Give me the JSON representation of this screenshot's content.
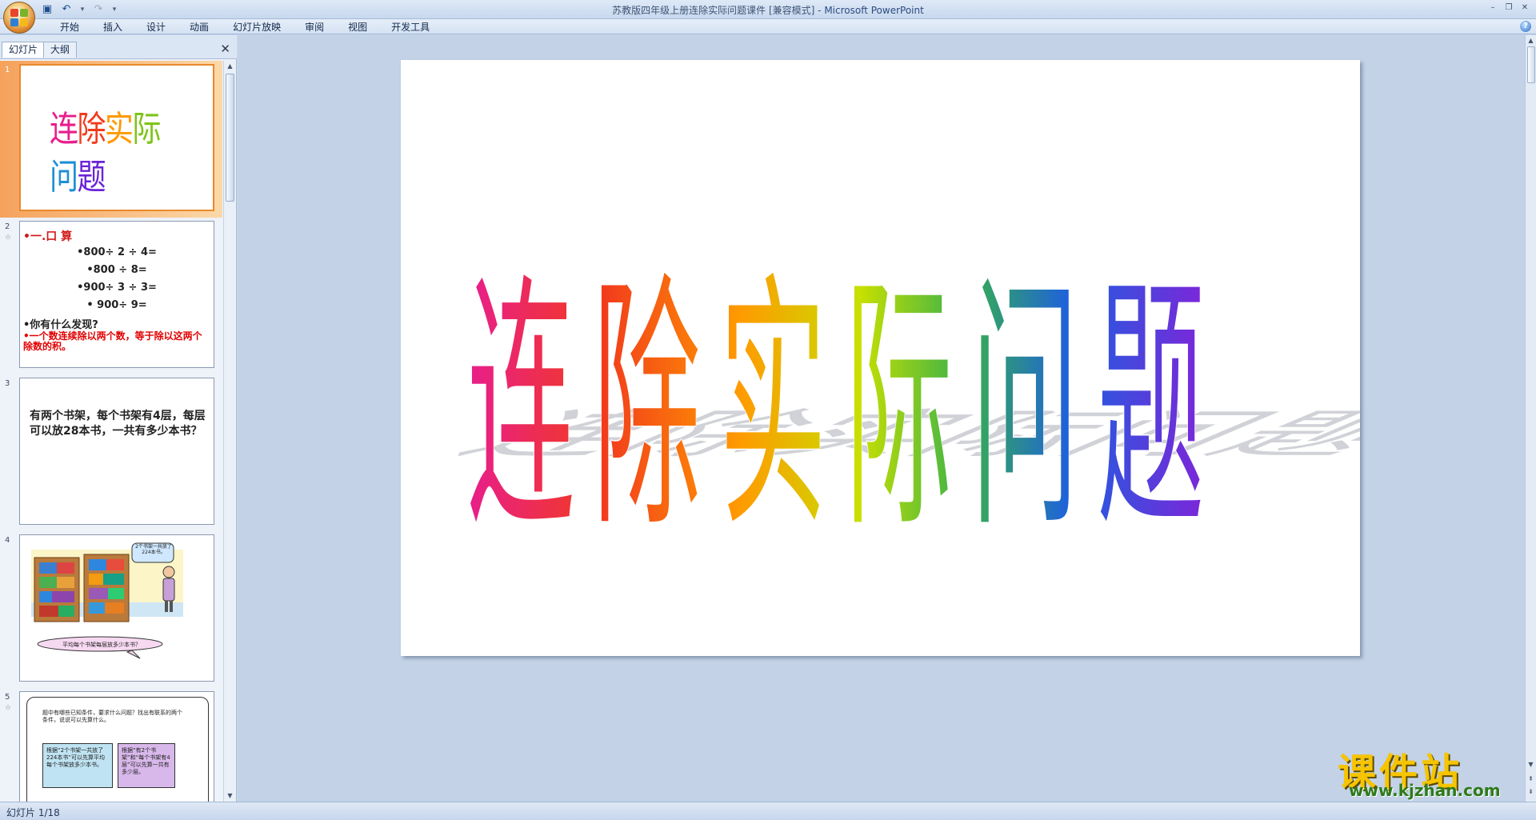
{
  "window": {
    "title": "苏教版四年级上册连除实际问题课件 [兼容模式]",
    "separator": " - ",
    "app_name": "Microsoft PowerPoint"
  },
  "qat": {
    "icons": [
      "save-icon",
      "undo-icon",
      "redo-icon",
      "customize-icon"
    ]
  },
  "ribbon": {
    "tabs": [
      "开始",
      "插入",
      "设计",
      "动画",
      "幻灯片放映",
      "审阅",
      "视图",
      "开发工具"
    ]
  },
  "left_panel": {
    "tabs": [
      "幻灯片",
      "大纲"
    ],
    "close_glyph": "✕",
    "slides": [
      {
        "num": "1",
        "title": "连除实际问题"
      },
      {
        "num": "2",
        "heading": "•一.口  算",
        "lines": [
          "•800÷ 2 ÷ 4=",
          "•800 ÷ 8=",
          "•900÷ 3 ÷ 3=",
          "• 900÷ 9="
        ],
        "question": "•你有什么发现?",
        "answer": "•一个数连续除以两个数，等于除以这两个除数的积。"
      },
      {
        "num": "3",
        "text": "有两个书架，每个书架有4层，每层可以放28本书，一共有多少本书？"
      },
      {
        "num": "4",
        "bubble": "2个书架一共放了224本书。",
        "prompt": "平均每个书架每层放多少本书？"
      },
      {
        "num": "5",
        "intro": "题中有哪些已知条件，要求什么问题？找出有联系的两个条件，说说可以先算什么。",
        "box_left": "根据“2个书架一共放了224本书”可以先算平均每个书架放多少本书。",
        "box_right": "根据“有2个书架”和“每个书架有4层”可以先算一共有多少层。"
      }
    ]
  },
  "slide": {
    "title": "连除实际问题",
    "title_colors": [
      "#e81e8c",
      "#f23b1c",
      "#ff9a00",
      "#7fc41a",
      "#1d8fd6",
      "#6a22d8"
    ]
  },
  "status": {
    "slide_counter": "幻灯片 1/18"
  },
  "watermark": {
    "name": "课件站",
    "url": "www.kjzhan.com"
  }
}
